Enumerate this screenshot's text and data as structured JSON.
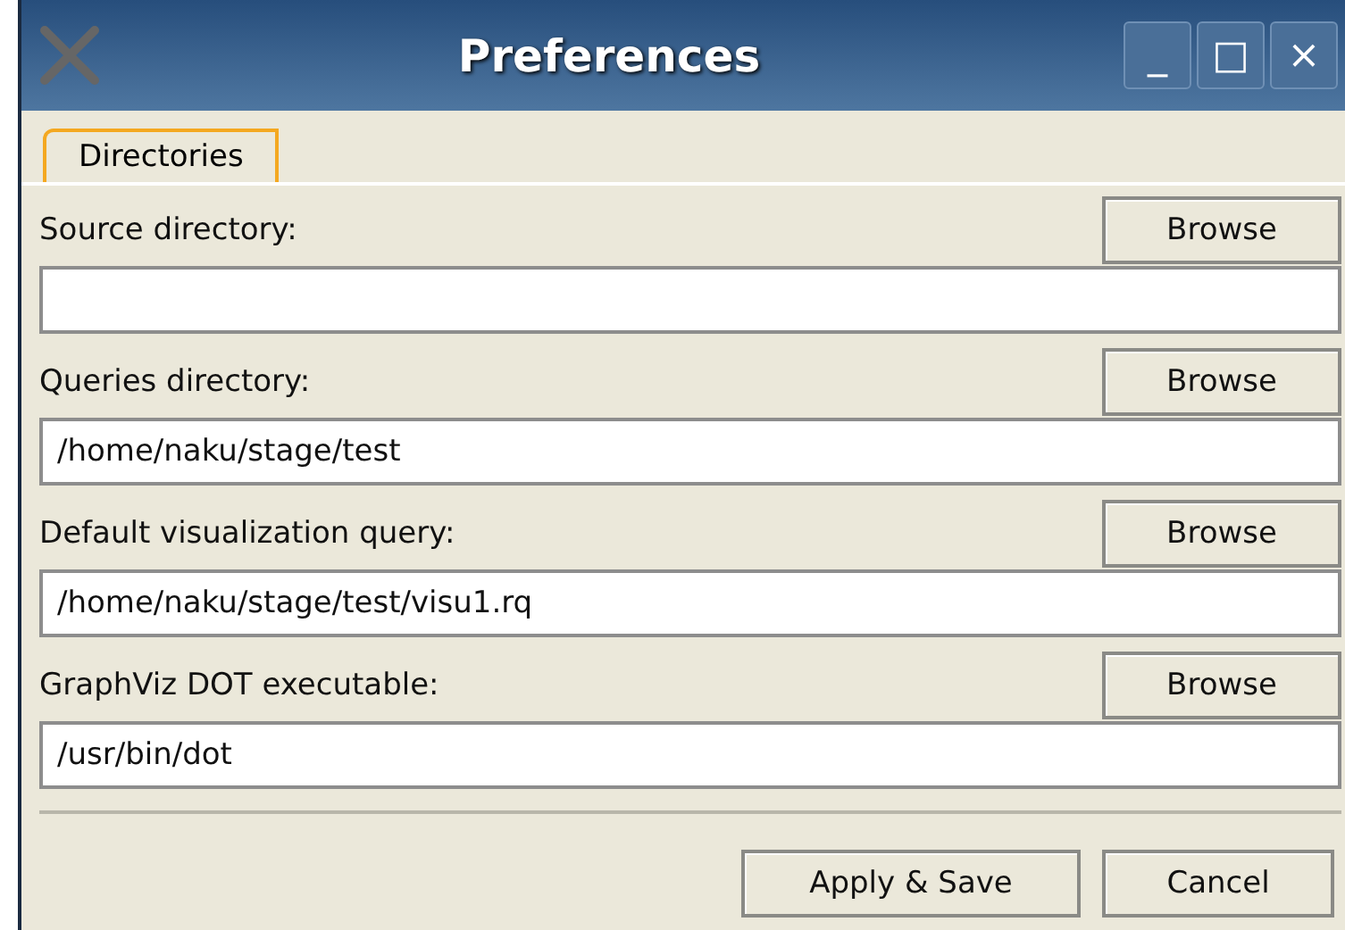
{
  "window": {
    "title": "Preferences",
    "controls": [
      "_",
      "□",
      "×"
    ]
  },
  "tabs": [
    {
      "label": "Directories",
      "selected": true
    }
  ],
  "settings": [
    {
      "label": "Source directory:",
      "button": "Browse"
    },
    {
      "label": "Queries directory:",
      "button": "Browse",
      "value": "/home/naku/stage/test"
    },
    {
      "label": "Default visualization query:",
      "button": "Browse",
      "value": "/home/naku/stage/test/visu1.rq"
    },
    {
      "label": "GraphViz DOT executable:",
      "button": "Browse",
      "value": "/usr/bin/dot"
    }
  ],
  "buttons": [
    "Apply & Save",
    "Cancel"
  ]
}
